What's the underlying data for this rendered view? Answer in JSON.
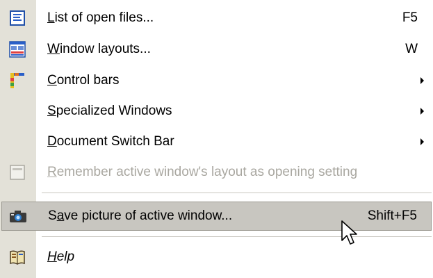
{
  "menu": {
    "items": [
      {
        "id": "list-open-files",
        "mnemonic": "L",
        "rest": "ist of open files...",
        "shortcut": "F5",
        "icon": "list-icon",
        "disabled": false
      },
      {
        "id": "window-layouts",
        "mnemonic": "W",
        "rest": "indow layouts...",
        "shortcut": "W",
        "icon": "window-layout-icon",
        "disabled": false
      },
      {
        "id": "control-bars",
        "mnemonic": "C",
        "rest": "ontrol bars",
        "submenu": true,
        "icon": "control-bars-icon",
        "disabled": false
      },
      {
        "id": "specialized-windows",
        "mnemonic": "S",
        "rest": "pecialized Windows",
        "submenu": true,
        "disabled": false
      },
      {
        "id": "document-switch-bar",
        "mnemonic": "D",
        "rest": "ocument Switch Bar",
        "submenu": true,
        "disabled": false
      },
      {
        "id": "remember-layout",
        "mnemonic": "R",
        "rest": "emember active window's layout as opening setting",
        "icon": "window-icon",
        "disabled": true
      },
      {
        "id": "save-picture",
        "before": "S",
        "mnemonic": "a",
        "rest": "ve picture of active window...",
        "shortcut": "Shift+F5",
        "icon": "camera-icon",
        "disabled": false,
        "selected": true
      },
      {
        "id": "help",
        "mnemonic": "H",
        "rest": "elp",
        "icon": "help-book-icon",
        "disabled": false,
        "italic": true
      }
    ]
  },
  "colors": {
    "gutter": "#e3e1d8",
    "selected_bg": "#c8c6c0",
    "disabled_text": "#a9a7a0"
  }
}
